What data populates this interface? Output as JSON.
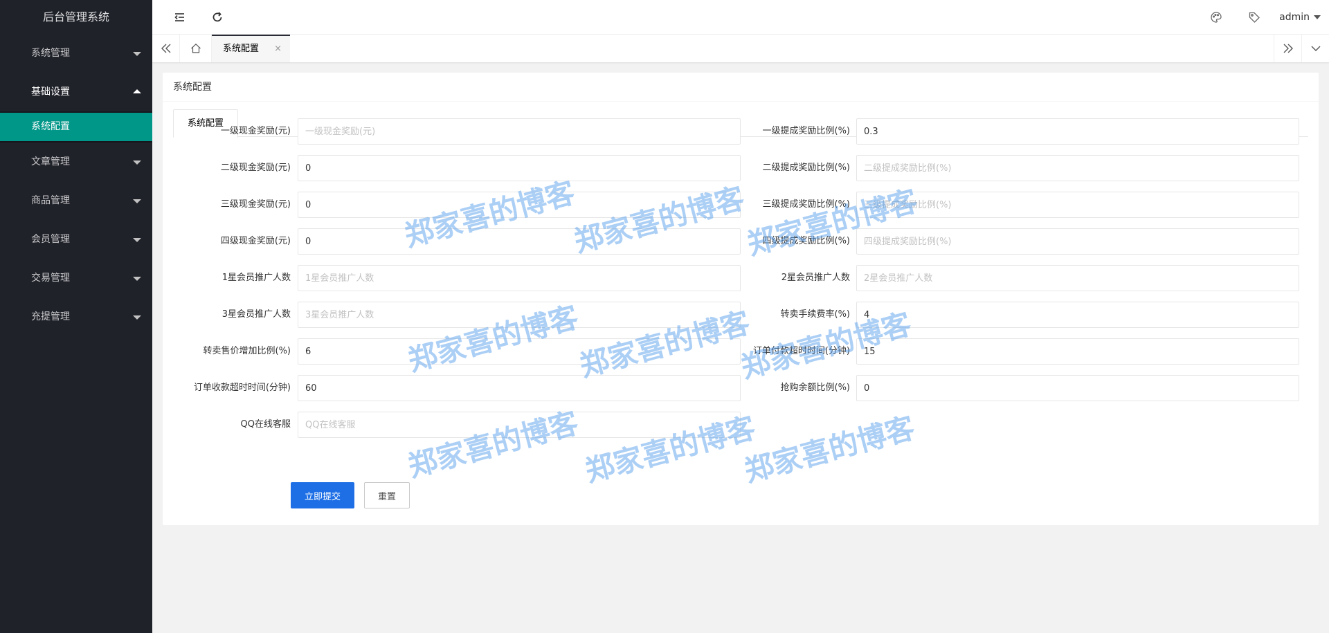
{
  "sidebar": {
    "title": "后台管理系统",
    "items": [
      {
        "label": "系统管理"
      },
      {
        "label": "基础设置"
      },
      {
        "label": "文章管理"
      },
      {
        "label": "商品管理"
      },
      {
        "label": "会员管理"
      },
      {
        "label": "交易管理"
      },
      {
        "label": "充提管理"
      }
    ],
    "sub_item": {
      "label": "系统配置"
    }
  },
  "header": {
    "user": "admin",
    "icons": [
      "menu-fold-icon",
      "refresh-icon",
      "theme-palette-icon",
      "tag-icon"
    ]
  },
  "tabsbar": {
    "active_tab": "系统配置",
    "close": "×"
  },
  "card": {
    "title": "系统配置",
    "inner_tab": "系统配置"
  },
  "form": {
    "fields": [
      {
        "label": "一级现金奖励(元)",
        "value": "",
        "placeholder": "一级现金奖励(元)"
      },
      {
        "label": "一级提成奖励比例(%)",
        "value": "0.3",
        "placeholder": "一级提成奖励比例(%)"
      },
      {
        "label": "二级现金奖励(元)",
        "value": "0",
        "placeholder": "二级现金奖励(元)"
      },
      {
        "label": "二级提成奖励比例(%)",
        "value": "",
        "placeholder": "二级提成奖励比例(%)"
      },
      {
        "label": "三级现金奖励(元)",
        "value": "0",
        "placeholder": "三级现金奖励(元)"
      },
      {
        "label": "三级提成奖励比例(%)",
        "value": "",
        "placeholder": "三级提成奖励比例(%)"
      },
      {
        "label": "四级现金奖励(元)",
        "value": "0",
        "placeholder": "四级现金奖励(元)"
      },
      {
        "label": "四级提成奖励比例(%)",
        "value": "",
        "placeholder": "四级提成奖励比例(%)"
      },
      {
        "label": "1星会员推广人数",
        "value": "",
        "placeholder": "1星会员推广人数"
      },
      {
        "label": "2星会员推广人数",
        "value": "",
        "placeholder": "2星会员推广人数"
      },
      {
        "label": "3星会员推广人数",
        "value": "",
        "placeholder": "3星会员推广人数"
      },
      {
        "label": "转卖手续费率(%)",
        "value": "4",
        "placeholder": "转卖手续费率(%)"
      },
      {
        "label": "转卖售价增加比例(%)",
        "value": "6",
        "placeholder": "转卖售价增加比例(%)"
      },
      {
        "label": "订单付款超时时间(分钟)",
        "value": "15",
        "placeholder": "订单付款超时时间(分钟)"
      },
      {
        "label": "订单收款超时时间(分钟)",
        "value": "60",
        "placeholder": "订单收款超时时间(分钟)"
      },
      {
        "label": "抢购余额比例(%)",
        "value": "0",
        "placeholder": "抢购余额比例(%)"
      },
      {
        "label": "QQ在线客服",
        "value": "",
        "placeholder": "QQ在线客服"
      }
    ],
    "submit_label": "立即提交",
    "reset_label": "重置"
  },
  "watermark": {
    "text": "郑家喜的博客"
  },
  "colors": {
    "sidebar_bg": "#20222a",
    "active_item": "#009688",
    "primary_button": "#1e6fe6",
    "watermark": "#5aa0eb"
  }
}
